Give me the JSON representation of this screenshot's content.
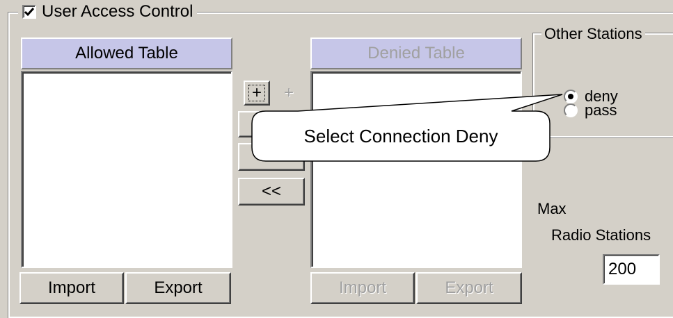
{
  "uac": {
    "label": "User Access Control",
    "checked": true
  },
  "allowed": {
    "title": "Allowed Table",
    "import_label": "Import",
    "export_label": "Export"
  },
  "denied": {
    "title": "Denied Table",
    "import_label": "Import",
    "export_label": "Export"
  },
  "mid_buttons": {
    "plus_label": "+",
    "plus2_label": "+",
    "move_right_label": ">>",
    "move_left_label": "<<"
  },
  "other_stations": {
    "label": "Other Stations",
    "deny_label": "deny",
    "pass_label": "pass",
    "selected": "deny"
  },
  "max": {
    "label": "Max",
    "sublabel": "Radio Stations",
    "value": "200"
  },
  "callout": {
    "text": "Select Connection Deny"
  }
}
